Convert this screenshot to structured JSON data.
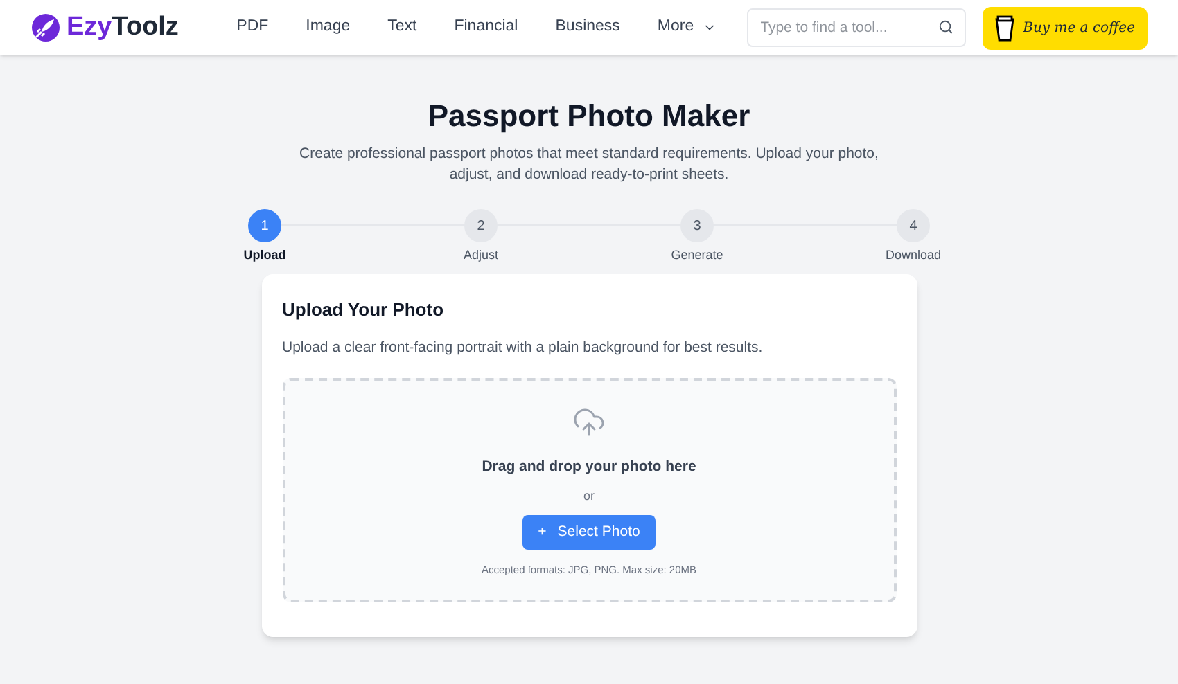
{
  "header": {
    "logo": "EzyToolz",
    "nav": [
      {
        "label": "PDF",
        "dropdown": false
      },
      {
        "label": "Image",
        "dropdown": false
      },
      {
        "label": "Text",
        "dropdown": false
      },
      {
        "label": "Financial",
        "dropdown": false
      },
      {
        "label": "Business",
        "dropdown": false
      },
      {
        "label": "More",
        "dropdown": true
      }
    ],
    "search": {
      "placeholder": "Type to find a tool..."
    },
    "coffee_button": "Buy me a coffee"
  },
  "title": "Passport Photo Maker",
  "subtitle": "Create professional passport photos that meet standard requirements. Upload your photo, adjust, and download ready-to-print sheets.",
  "steps": [
    {
      "number": "1",
      "label": "Upload",
      "selected": true
    },
    {
      "number": "2",
      "label": "Adjust",
      "selected": false
    },
    {
      "number": "3",
      "label": "Generate",
      "selected": false
    },
    {
      "number": "4",
      "label": "Download",
      "selected": false
    }
  ],
  "card": {
    "title": "Upload Your Photo",
    "description": "Upload a clear front-facing portrait with a plain background for best results.",
    "dropzone": {
      "heading": "Drag and drop your photo here",
      "or": "or",
      "button_icon": "+",
      "button": "Select Photo",
      "note": "Accepted formats: JPG, PNG. Max size: 20MB"
    }
  }
}
